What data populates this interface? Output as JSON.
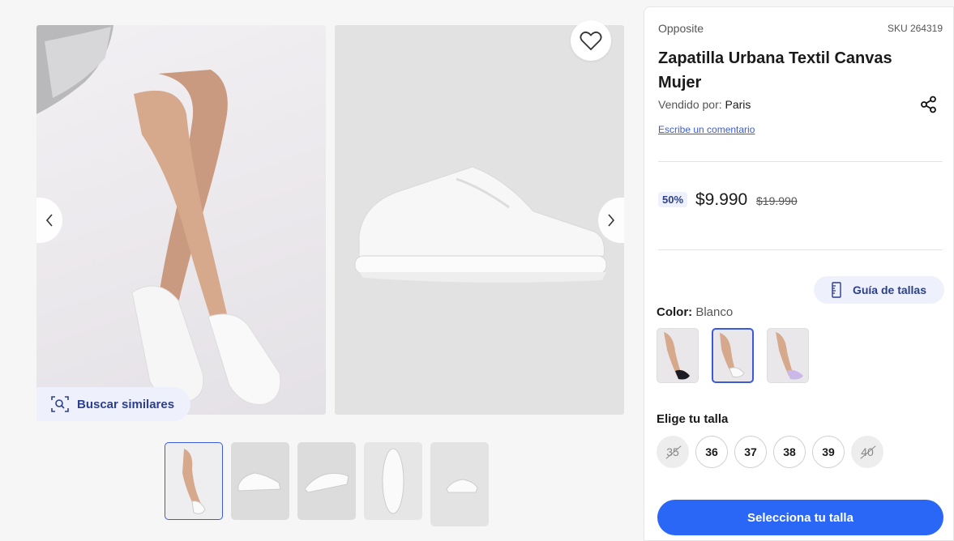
{
  "product": {
    "brand": "Opposite",
    "sku": "SKU 264319",
    "title": "Zapatilla Urbana Textil Canvas Mujer",
    "seller_prefix": "Vendido por:",
    "seller_name": "Paris",
    "comment_link": "Escribe un comentario"
  },
  "pricing": {
    "discount": "50%",
    "price": "$9.990",
    "old_price": "$19.990"
  },
  "gallery": {
    "similar_label": "Buscar similares"
  },
  "size_guide": {
    "label": "Guía de tallas"
  },
  "color": {
    "label": "Color:",
    "value": "Blanco",
    "swatches": [
      "black-sneaker",
      "white-sneaker",
      "lilac-sneaker"
    ],
    "selected_index": 1
  },
  "sizes": {
    "label": "Elige tu talla",
    "options": [
      {
        "value": "35",
        "available": false
      },
      {
        "value": "36",
        "available": true
      },
      {
        "value": "37",
        "available": true
      },
      {
        "value": "38",
        "available": true
      },
      {
        "value": "39",
        "available": true
      },
      {
        "value": "40",
        "available": false
      }
    ]
  },
  "cta": {
    "label": "Selecciona tu talla"
  },
  "colors": {
    "accent": "#2b67f6",
    "accent_dark": "#2b3f8c",
    "badge_bg": "#eef1fb"
  }
}
